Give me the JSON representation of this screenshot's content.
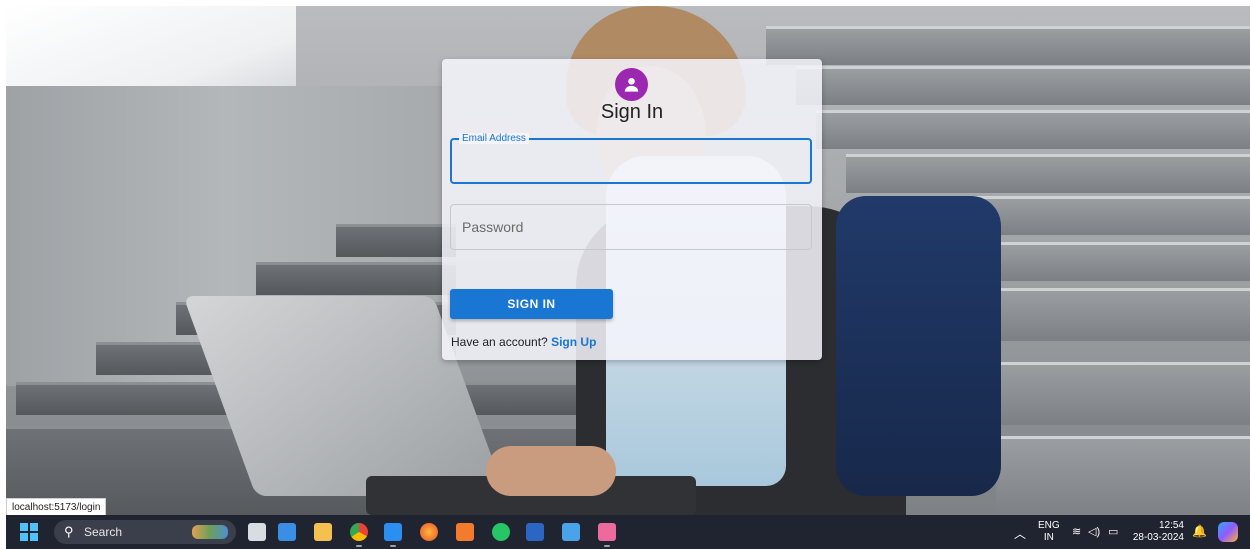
{
  "login": {
    "title": "Sign In",
    "email_label": "Email Address",
    "email_value": "",
    "password_placeholder": "Password",
    "submit_label": "SIGN IN",
    "account_prompt": "Have an account?",
    "signup_label": "Sign Up"
  },
  "status_url": "localhost:5173/login",
  "taskbar": {
    "search_label": "Search",
    "apps": [
      "file-explorer-icon",
      "widgets-icon",
      "folder-icon",
      "chrome-icon",
      "vscode-icon",
      "firefox-icon",
      "xampp-icon",
      "whatsapp-icon",
      "word-icon",
      "notepad-icon",
      "snipping-tool-icon"
    ],
    "tray": {
      "language": "ENG",
      "region": "IN",
      "time": "12:54",
      "date": "28-03-2024"
    }
  },
  "colors": {
    "primary": "#1976d2",
    "avatar": "#9c27b0",
    "taskbar": "#1f2430"
  }
}
